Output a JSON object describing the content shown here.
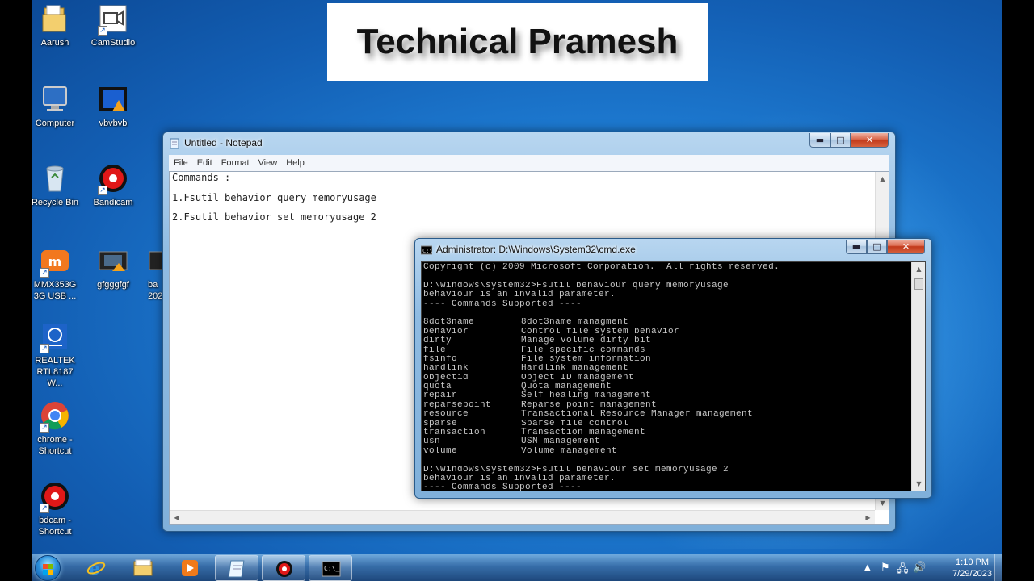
{
  "banner": {
    "text": "Technical Pramesh"
  },
  "desktop": {
    "icons": [
      {
        "label": "Aarush"
      },
      {
        "label": "CamStudio"
      },
      {
        "label": "Computer"
      },
      {
        "label": "vbvbvb"
      },
      {
        "label": "Recycle Bin"
      },
      {
        "label": "Bandicam"
      },
      {
        "label": "MMX353G\n3G USB ..."
      },
      {
        "label": "gfgggfgf"
      },
      {
        "label": "ba\n2023"
      },
      {
        "label": "REALTEK\nRTL8187 W..."
      },
      {
        "label": "chrome -\nShortcut"
      },
      {
        "label": "bdcam -\nShortcut"
      }
    ]
  },
  "notepad": {
    "title": "Untitled - Notepad",
    "menu": [
      "File",
      "Edit",
      "Format",
      "View",
      "Help"
    ],
    "lines": [
      "Commands :-",
      "1.Fsutil behavior query memoryusage",
      "2.Fsutil behavior set memoryusage 2"
    ],
    "buttons": {
      "minimize": "▬",
      "maximize": "□",
      "close": "✕"
    }
  },
  "cmd": {
    "title": "Administrator: D:\\Windows\\System32\\cmd.exe",
    "lines_before": [
      "Copyright (c) 2009 Microsoft Corporation.  All rights reserved.",
      "",
      "D:\\Windows\\system32>Fsutil behaviour query memoryusage",
      "behaviour is an invalid parameter.",
      "---- Commands Supported ----",
      ""
    ],
    "commands": [
      {
        "name": "8dot3name",
        "desc": "8dot3name managment"
      },
      {
        "name": "behavior",
        "desc": "Control file system behavior"
      },
      {
        "name": "dirty",
        "desc": "Manage volume dirty bit"
      },
      {
        "name": "file",
        "desc": "File specific commands"
      },
      {
        "name": "fsinfo",
        "desc": "File system information"
      },
      {
        "name": "hardlink",
        "desc": "Hardlink management"
      },
      {
        "name": "objectid",
        "desc": "Object ID management"
      },
      {
        "name": "quota",
        "desc": "Quota management"
      },
      {
        "name": "repair",
        "desc": "Self healing management"
      },
      {
        "name": "reparsepoint",
        "desc": "Reparse point management"
      },
      {
        "name": "resource",
        "desc": "Transactional Resource Manager management"
      },
      {
        "name": "sparse",
        "desc": "Sparse file control"
      },
      {
        "name": "transaction",
        "desc": "Transaction management"
      },
      {
        "name": "usn",
        "desc": "USN management"
      },
      {
        "name": "volume",
        "desc": "Volume management"
      }
    ],
    "lines_after": [
      "",
      "D:\\Windows\\system32>Fsutil behaviour set memoryusage 2",
      "behaviour is an invalid parameter.",
      "---- Commands Supported ----"
    ]
  },
  "taskbar": {
    "time": "1:10 PM",
    "date": "7/29/2023",
    "items": [
      {
        "name": "internet-explorer"
      },
      {
        "name": "file-explorer"
      },
      {
        "name": "media-player"
      },
      {
        "name": "notepad",
        "active": true
      },
      {
        "name": "bandicam",
        "active": true
      },
      {
        "name": "command-prompt",
        "active": true
      }
    ],
    "tray_icons": [
      "show-hidden-icons",
      "action-center-flag",
      "network-icon",
      "volume-icon"
    ]
  },
  "colors": {
    "desktop_blue": "#1f7fd6",
    "console_bg": "#000000",
    "console_text": "#c8c8c8",
    "close_red": "#c2391b"
  }
}
